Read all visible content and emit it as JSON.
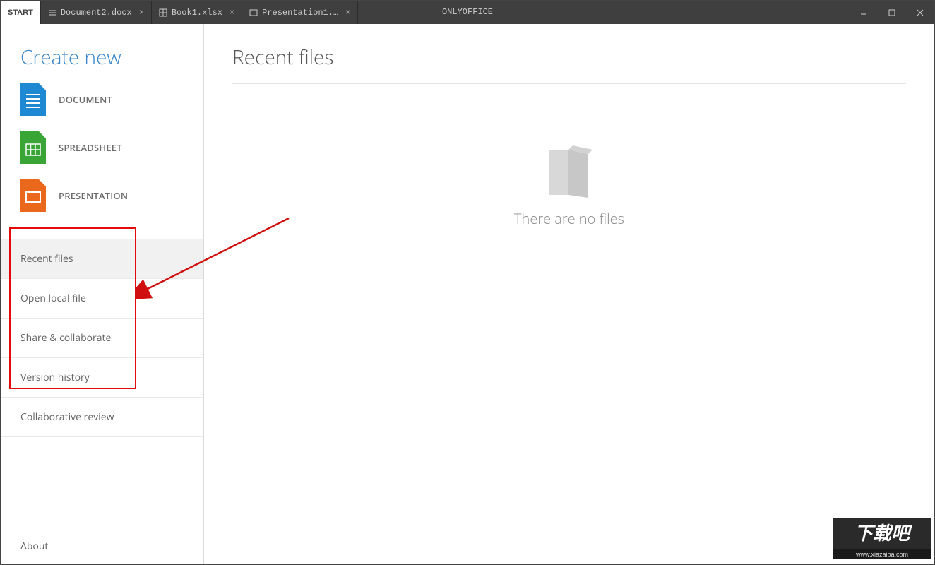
{
  "app_title": "ONLYOFFICE",
  "tabs": [
    {
      "label": "START",
      "type": "start"
    },
    {
      "label": "Document2.docx",
      "type": "doc"
    },
    {
      "label": "Book1.xlsx",
      "type": "sheet"
    },
    {
      "label": "Presentation1.…",
      "type": "pres"
    }
  ],
  "sidebar": {
    "create_title": "Create new",
    "create_items": [
      {
        "label": "DOCUMENT"
      },
      {
        "label": "SPREADSHEET"
      },
      {
        "label": "PRESENTATION"
      }
    ],
    "nav_items": [
      {
        "label": "Recent files",
        "selected": true
      },
      {
        "label": "Open local file"
      },
      {
        "label": "Share & collaborate"
      },
      {
        "label": "Version history"
      },
      {
        "label": "Collaborative review"
      }
    ],
    "about_label": "About"
  },
  "main": {
    "title": "Recent files",
    "empty_text": "There are no files"
  },
  "watermark": {
    "big": "下载吧",
    "small": "www.xiazaiba.com"
  }
}
